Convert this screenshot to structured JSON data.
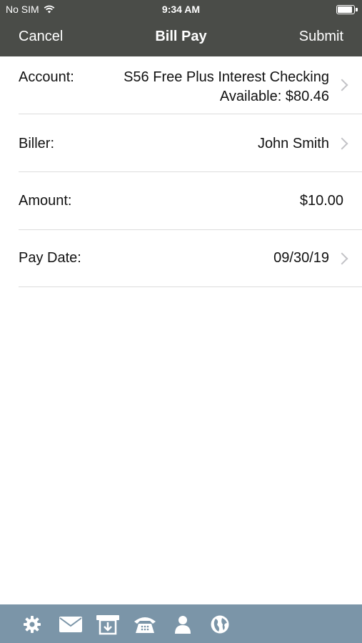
{
  "status": {
    "carrier": "No SIM",
    "time": "9:34 AM"
  },
  "nav": {
    "cancel": "Cancel",
    "title": "Bill Pay",
    "submit": "Submit"
  },
  "form": {
    "account": {
      "label": "Account:",
      "value": "S56 Free Plus Interest Checking",
      "available": "Available: $80.46"
    },
    "biller": {
      "label": "Biller:",
      "value": "John Smith"
    },
    "amount": {
      "label": "Amount:",
      "value": "$10.00"
    },
    "pay_date": {
      "label": "Pay Date:",
      "value": "09/30/19"
    }
  },
  "tabs": [
    "gear-icon",
    "mail-icon",
    "deposit-icon",
    "phone-icon",
    "person-icon",
    "globe-icon"
  ],
  "colors": {
    "header": "#4a4c48",
    "tabbar": "#7b95a8",
    "background": "#ffffff"
  }
}
